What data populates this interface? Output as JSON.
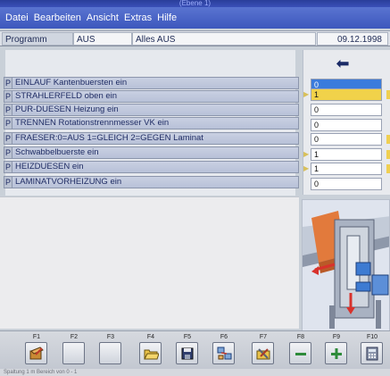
{
  "window": {
    "title": "(Ebene 1)"
  },
  "menu": {
    "items": [
      "Datei",
      "Bearbeiten",
      "Ansicht",
      "Extras",
      "Hilfe"
    ]
  },
  "info": {
    "programm_label": "Programm",
    "programm_value": "AUS",
    "description": "Alles AUS",
    "date": "09.12.1998"
  },
  "parameters": [
    {
      "flag": "P",
      "label": "EINLAUF  Kantenbuersten ein",
      "value": "0"
    },
    {
      "flag": "P",
      "label": "STRAHLERFELD  oben ein",
      "value": "1"
    },
    {
      "flag": "P",
      "label": "PUR-DUESEN  Heizung ein",
      "value": "0"
    },
    {
      "flag": "P",
      "label": "TRENNEN  Rotationstrennmesser VK ein",
      "value": "0"
    },
    {
      "flag": "P",
      "label": "FRAESER:0=AUS 1=GLEICH 2=GEGEN  Laminat",
      "value": "0"
    },
    {
      "flag": "P",
      "label": "Schwabbelbuerste ein",
      "value": "1"
    },
    {
      "flag": "P",
      "label": "HEIZDUESEN ein",
      "value": "1"
    },
    {
      "flag": "P",
      "label": "LAMINATVORHEIZUNG ein",
      "value": "0"
    }
  ],
  "top_value": "0",
  "arrow_icon": "left-arrow-icon",
  "function_keys": [
    {
      "label": "F1",
      "icon": "book-edit-icon"
    },
    {
      "label": "F2",
      "icon": "blank-icon"
    },
    {
      "label": "F3",
      "icon": "blank-icon"
    },
    {
      "label": "F4",
      "icon": "folder-icon"
    },
    {
      "label": "F5",
      "icon": "save-icon"
    },
    {
      "label": "F6",
      "icon": "network-icon"
    },
    {
      "label": "F7",
      "icon": "tools-icon"
    },
    {
      "label": "F8",
      "icon": "minus-icon"
    },
    {
      "label": "F9",
      "icon": "plus-icon"
    },
    {
      "label": "F10",
      "icon": "calculator-icon"
    }
  ],
  "status": {
    "text": "Spaltung 1 m Bereich von 0 - 1"
  },
  "colors": {
    "menubar": "#3c57bd",
    "selected_value": "#f1d24a",
    "active_value": "#3a7bdc"
  }
}
